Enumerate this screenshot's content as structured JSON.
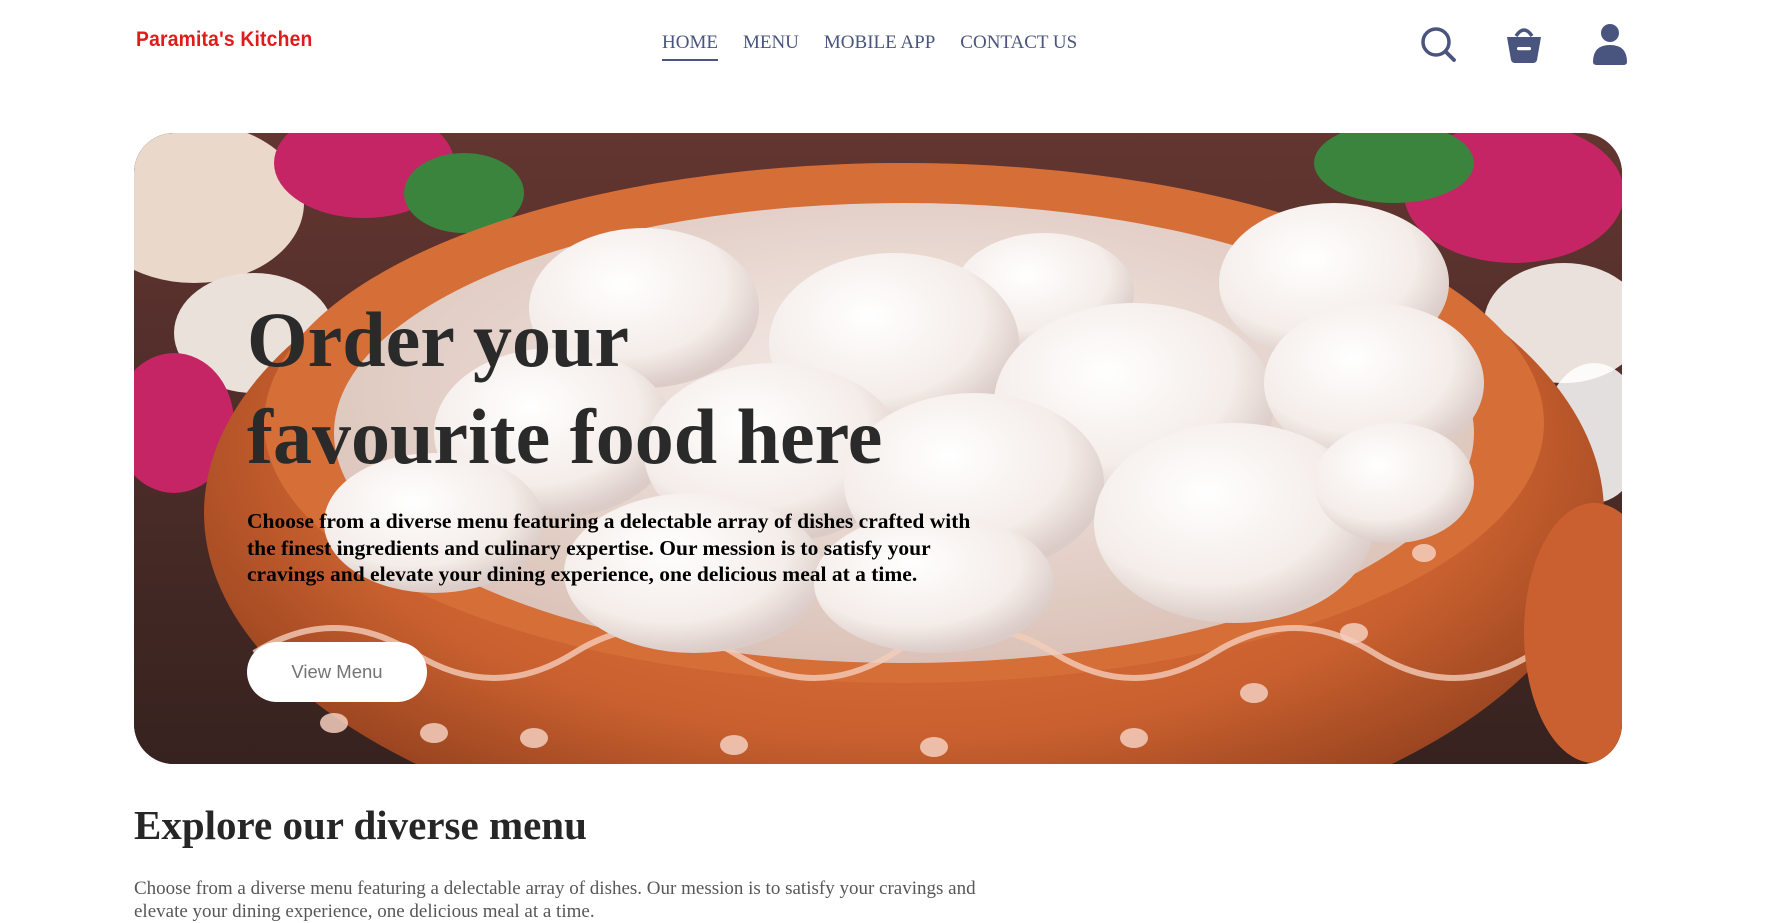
{
  "header": {
    "logo": "Paramita's Kitchen",
    "nav": [
      {
        "label": "HOME",
        "active": true
      },
      {
        "label": "MENU",
        "active": false
      },
      {
        "label": "MOBILE APP",
        "active": false
      },
      {
        "label": "CONTACT US",
        "active": false
      }
    ],
    "icons": [
      "search-icon",
      "basket-icon",
      "profile-icon"
    ],
    "nav_color": "#49557e",
    "logo_color": "#e01b1b"
  },
  "hero": {
    "title_line1": "Order your",
    "title_line2": "favourite food here",
    "description": "Choose from a diverse menu featuring a delectable array of dishes crafted with the finest ingredients and culinary expertise. Our mession is to satisfy your cravings and elevate your dining experience, one delicious meal at a time.",
    "button_label": "View Menu"
  },
  "explore": {
    "title": "Explore our diverse menu",
    "description": "Choose from a diverse menu featuring a delectable array of dishes. Our mession is to satisfy your cravings and elevate your dining experience, one delicious meal at a time."
  }
}
